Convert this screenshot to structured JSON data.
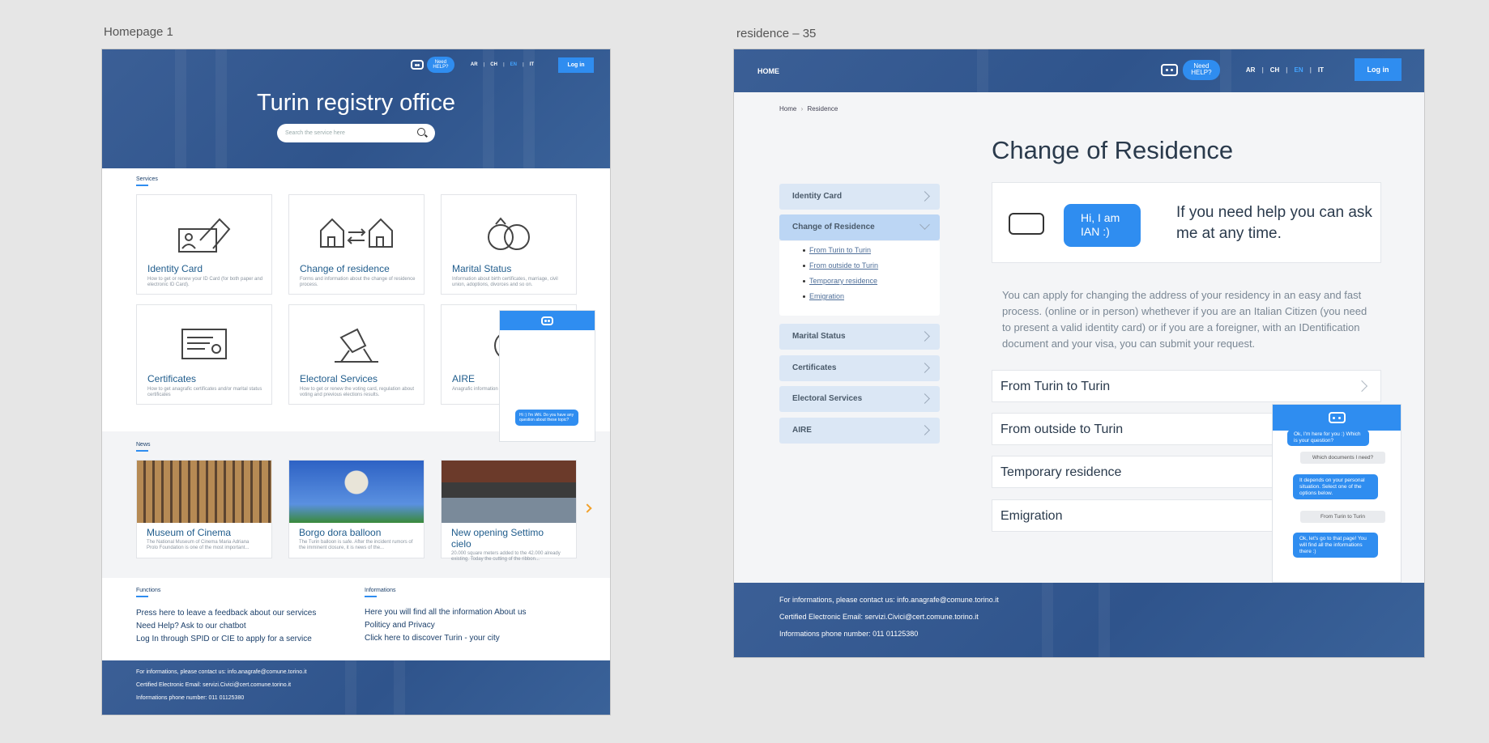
{
  "frames": {
    "home_title": "Homepage 1",
    "res_title": "residence – 35"
  },
  "header": {
    "need_help_1": "Need",
    "need_help_2": "HELP?",
    "langs": [
      "AR",
      "CH",
      "EN",
      "IT"
    ],
    "login": "Log in",
    "home": "HOME"
  },
  "home": {
    "title": "Turin registry office",
    "search_placeholder": "Search the service here",
    "services_label": "Services",
    "services": [
      {
        "title": "Identity Card",
        "desc": "How to get or renew your ID Card (for both paper and electronic ID Card)."
      },
      {
        "title": "Change of residence",
        "desc": "Forms and information about the change of residence process."
      },
      {
        "title": "Marital Status",
        "desc": "Information about birth certificates, marriage, civil union, adoptions, divorces and so on."
      },
      {
        "title": "Certificates",
        "desc": "How to get anagrafic certificates and/or marital status certificates"
      },
      {
        "title": "Electoral Services",
        "desc": "How to get or renew the voting card, regulation about voting and previous elections results."
      },
      {
        "title": "AIRE",
        "desc": "Anagrafic information abroad"
      }
    ],
    "news_label": "News",
    "news": [
      {
        "title": "Museum of Cinema",
        "desc": "The National Museum of Cinema Maria Adriana Prolo Foundation is one of the most important..."
      },
      {
        "title": "Borgo dora balloon",
        "desc": "The Turin balloon is safe. After the incident rumors of the imminent closure, it is news of the..."
      },
      {
        "title": "New opening Settimo cielo",
        "desc": "20.000 square meters added to the 42.000 already existing. Today the cutting of the ribbon..."
      }
    ],
    "chat_msg": "Hi :) I'm IAN. Do you have any question about these topic?",
    "functions_label": "Functions",
    "functions": [
      "Press here to leave a feedback about our services",
      "Need Help? Ask to our chatbot",
      "Log In through SPID or CIE to apply for a service"
    ],
    "info_label": "Informations",
    "informations": [
      "Here you will find all the information About us",
      "Politicy and Privacy",
      "Click here to discover Turin - your city"
    ]
  },
  "footer": {
    "contact": "For informations, please contact us: info.anagrafe@comune.torino.it",
    "email": "Certified Electronic Email: servizi.Civici@cert.comune.torino.it",
    "phone": "Informations phone number: 011 01125380"
  },
  "res": {
    "breadcrumb_home": "Home",
    "breadcrumb_sep": "›",
    "breadcrumb_current": "Residence",
    "title": "Change of Residence",
    "sidebar": [
      "Identity Card",
      "Change of Residence",
      "Marital Status",
      "Certificates",
      "Electoral Services",
      "AIRE"
    ],
    "sub_links": [
      "From Turin to Turin",
      "From outside to Turin",
      "Temporary residence",
      "Emigration"
    ],
    "bot_bubble": "Hi, I am IAN :)",
    "help_text": "If you need help you can ask me at any time.",
    "paragraph": "You can apply for changing the address of your residency in an easy and fast process. (online or in person) whethever if you are an Italian Citizen (you need to present a valid identity card) or if you are a foreigner, with an IDentification document and your visa, you can submit your request.",
    "options": [
      "From Turin to Turin",
      "From outside to Turin",
      "Temporary residence",
      "Emigration"
    ],
    "chat": {
      "m1": "Ok, I'm here for you :) Which is your question?",
      "u1": "Which documents I need?",
      "m2": "It depends on your personal situation. Select one of the options below.",
      "u2": "From Turin to Turin",
      "m3": "Ok, let's go to that page! You will find all the informations there :)"
    }
  },
  "colors": {
    "brand_blue": "#2f548c",
    "accent": "#2f8df0"
  }
}
